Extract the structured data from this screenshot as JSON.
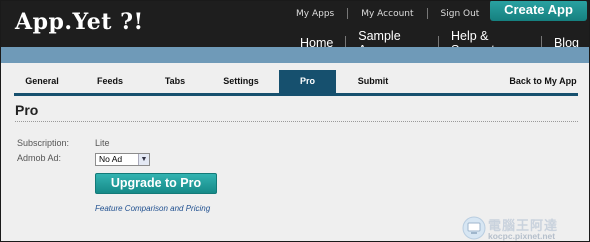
{
  "header": {
    "logo": "App.Yet ?!",
    "top_links": [
      "My Apps",
      "My Account",
      "Sign Out"
    ],
    "create_button": "Create App",
    "main_nav": [
      "Home",
      "Sample Apps",
      "Help & Support",
      "Blog"
    ]
  },
  "tabs": {
    "items": [
      "General",
      "Feeds",
      "Tabs",
      "Settings",
      "Pro",
      "Submit"
    ],
    "active": "Pro",
    "back_link": "Back to My App"
  },
  "page": {
    "title": "Pro",
    "subscription_label": "Subscription:",
    "subscription_value": "Lite",
    "admob_label": "Admob Ad:",
    "admob_selected": "No Ad",
    "upgrade_button": "Upgrade to Pro",
    "compare_link": "Feature Comparison and Pricing"
  },
  "watermark": {
    "text": "電腦王阿達",
    "url": "kocpc.pixnet.net"
  },
  "colors": {
    "header_bg": "#1e1e1e",
    "band": "#6f9ab8",
    "tab_active": "#16506e",
    "teal_button": "#1f9896",
    "content_bg": "#efefef"
  }
}
